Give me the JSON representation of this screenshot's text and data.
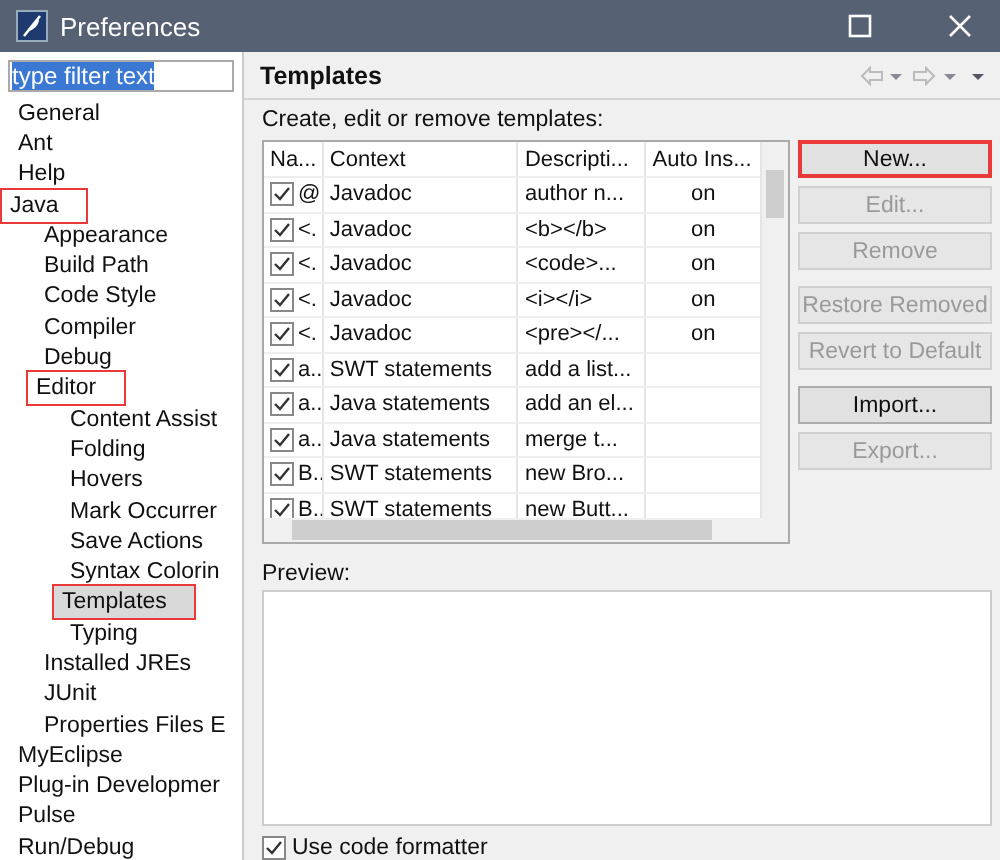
{
  "window": {
    "title": "Preferences"
  },
  "filter": {
    "value": "type filter text"
  },
  "tree": [
    {
      "label": "General",
      "selected": false,
      "annotated": false
    },
    {
      "label": "Ant",
      "selected": false,
      "annotated": false
    },
    {
      "label": "Help",
      "selected": false,
      "annotated": false
    },
    {
      "label": "Java",
      "selected": false,
      "annotated": true,
      "children": [
        {
          "label": "Appearance",
          "selected": false,
          "annotated": false
        },
        {
          "label": "Build Path",
          "selected": false,
          "annotated": false
        },
        {
          "label": "Code Style",
          "selected": false,
          "annotated": false
        },
        {
          "label": "Compiler",
          "selected": false,
          "annotated": false
        },
        {
          "label": "Debug",
          "selected": false,
          "annotated": false
        },
        {
          "label": "Editor",
          "selected": false,
          "annotated": true,
          "children": [
            {
              "label": "Content Assist",
              "selected": false,
              "annotated": false
            },
            {
              "label": "Folding",
              "selected": false,
              "annotated": false
            },
            {
              "label": "Hovers",
              "selected": false,
              "annotated": false
            },
            {
              "label": "Mark Occurrer",
              "selected": false,
              "annotated": false
            },
            {
              "label": "Save Actions",
              "selected": false,
              "annotated": false
            },
            {
              "label": "Syntax Colorin",
              "selected": false,
              "annotated": false
            },
            {
              "label": "Templates",
              "selected": true,
              "annotated": true
            },
            {
              "label": "Typing",
              "selected": false,
              "annotated": false
            }
          ]
        },
        {
          "label": "Installed JREs",
          "selected": false,
          "annotated": false
        },
        {
          "label": "JUnit",
          "selected": false,
          "annotated": false
        },
        {
          "label": "Properties Files E",
          "selected": false,
          "annotated": false
        }
      ]
    },
    {
      "label": "MyEclipse",
      "selected": false,
      "annotated": false
    },
    {
      "label": "Plug-in Developmer",
      "selected": false,
      "annotated": false
    },
    {
      "label": "Pulse",
      "selected": false,
      "annotated": false
    },
    {
      "label": "Run/Debug",
      "selected": false,
      "annotated": false
    }
  ],
  "page": {
    "title": "Templates",
    "intro": "Create, edit or remove templates:"
  },
  "table": {
    "columns": [
      "Na...",
      "Context",
      "Descripti...",
      "Auto Ins..."
    ],
    "rows": [
      {
        "checked": true,
        "name": "@",
        "context": "Javadoc",
        "description": "author n...",
        "auto_insert": "on"
      },
      {
        "checked": true,
        "name": "<.",
        "context": "Javadoc",
        "description": "<b></b>",
        "auto_insert": "on"
      },
      {
        "checked": true,
        "name": "<.",
        "context": "Javadoc",
        "description": "<code>...",
        "auto_insert": "on"
      },
      {
        "checked": true,
        "name": "<.",
        "context": "Javadoc",
        "description": "<i></i>",
        "auto_insert": "on"
      },
      {
        "checked": true,
        "name": "<.",
        "context": "Javadoc",
        "description": "<pre></...",
        "auto_insert": "on"
      },
      {
        "checked": true,
        "name": "a..",
        "context": "SWT statements",
        "description": "add a list..."
      },
      {
        "checked": true,
        "name": "a..",
        "context": "Java statements",
        "description": "add an el..."
      },
      {
        "checked": true,
        "name": "a..",
        "context": "Java statements",
        "description": "merge t..."
      },
      {
        "checked": true,
        "name": "B..",
        "context": "SWT statements",
        "description": "new Bro..."
      },
      {
        "checked": true,
        "name": "B..",
        "context": "SWT statements",
        "description": "new Butt..."
      }
    ]
  },
  "button_groups": [
    [
      {
        "label": "New...",
        "disabled": false,
        "annotated": true
      },
      {
        "label": "Edit...",
        "disabled": true,
        "annotated": false
      },
      {
        "label": "Remove",
        "disabled": true,
        "annotated": false
      }
    ],
    [
      {
        "label": "Restore Removed",
        "disabled": true,
        "annotated": false
      },
      {
        "label": "Revert to Default",
        "disabled": true,
        "annotated": false
      }
    ],
    [
      {
        "label": "Import...",
        "disabled": false,
        "annotated": false
      },
      {
        "label": "Export...",
        "disabled": true,
        "annotated": false
      }
    ]
  ],
  "preview": {
    "label": "Preview:"
  },
  "formatter": {
    "label": "Use code formatter",
    "checked": true
  }
}
